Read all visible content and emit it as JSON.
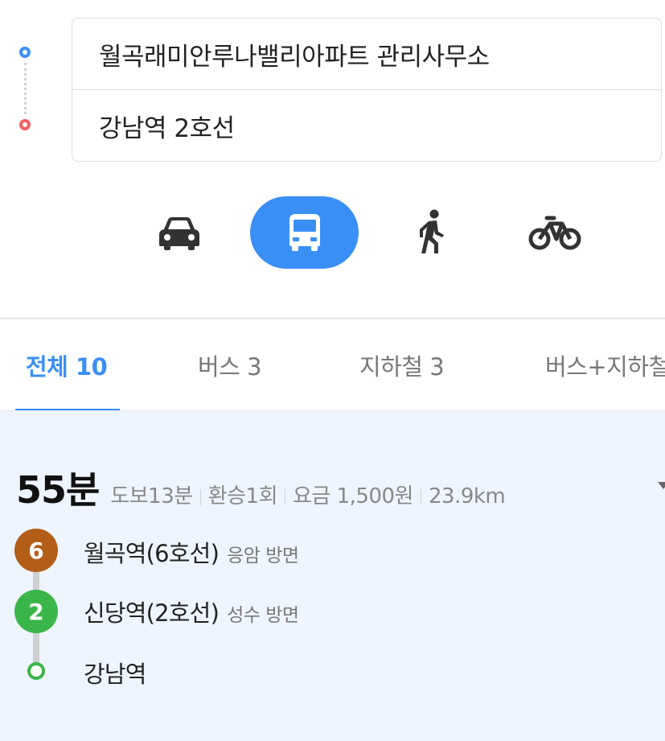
{
  "route": {
    "origin": "월곡래미안루나밸리아파트 관리사무소",
    "destination": "강남역 2호선"
  },
  "modes": [
    {
      "name": "car",
      "icon": "car-icon",
      "active": false
    },
    {
      "name": "transit",
      "icon": "bus-icon",
      "active": true
    },
    {
      "name": "walk",
      "icon": "walk-icon",
      "active": false
    },
    {
      "name": "bike",
      "icon": "bicycle-icon",
      "active": false
    }
  ],
  "tabs": [
    {
      "label": "전체 10",
      "active": true
    },
    {
      "label": "버스 3",
      "active": false
    },
    {
      "label": "지하철 3",
      "active": false
    },
    {
      "label": "버스+지하철",
      "active": false
    }
  ],
  "result": {
    "duration": "55분",
    "walk": "도보13분",
    "transfer": "환승1회",
    "fare": "요금 1,500원",
    "distance": "23.9km",
    "steps": [
      {
        "badge": "6",
        "line_color": "#b25e19",
        "station": "월곡역(6호선)",
        "direction": "응암 방면"
      },
      {
        "badge": "2",
        "line_color": "#3ab54a",
        "station": "신당역(2호선)",
        "direction": "성수 방면"
      },
      {
        "badge": "",
        "line_color": "#3ab54a",
        "station": "강남역",
        "direction": ""
      }
    ]
  },
  "colors": {
    "accent": "#3a8ff6",
    "origin_dot": "#3a8ff6",
    "destination_dot": "#f06060",
    "line6": "#b25e19",
    "line2": "#3ab54a"
  }
}
